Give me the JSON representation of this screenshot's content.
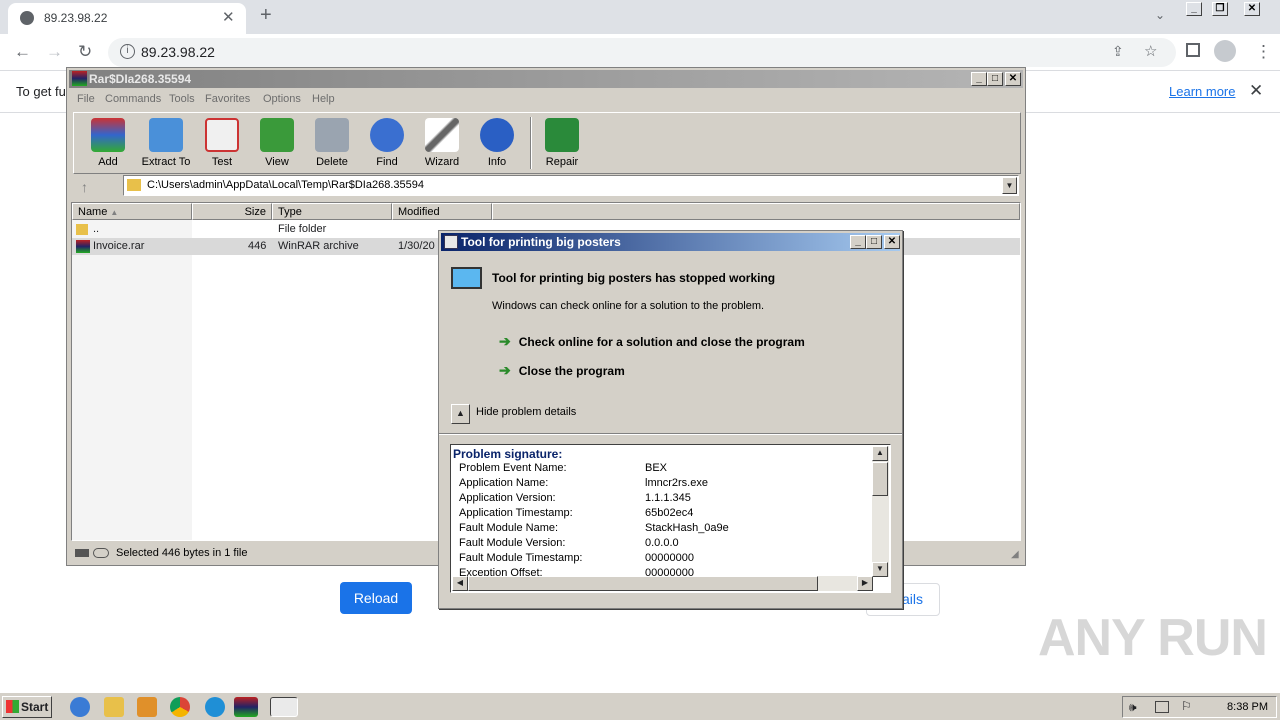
{
  "browser": {
    "tab_title": "89.23.98.22",
    "tab_close": "✕",
    "new_tab": "+",
    "url": "89.23.98.22",
    "infobar_text": "To get fu",
    "learn_more": "Learn more",
    "infobar_close": "✕",
    "reload_label": "Reload",
    "details_label": "ails"
  },
  "winrar": {
    "title": "Rar$DIa268.35594",
    "menu": [
      "File",
      "Commands",
      "Tools",
      "Favorites",
      "Options",
      "Help"
    ],
    "toolbar": [
      "Add",
      "Extract To",
      "Test",
      "View",
      "Delete",
      "Find",
      "Wizard",
      "Info",
      "Repair"
    ],
    "path": "C:\\Users\\admin\\AppData\\Local\\Temp\\Rar$DIa268.35594",
    "columns": {
      "name": "Name",
      "size": "Size",
      "type": "Type",
      "modified": "Modified"
    },
    "rows": [
      {
        "name": "..",
        "size": "",
        "type": "File folder",
        "modified": ""
      },
      {
        "name": "Invoice.rar",
        "size": "446",
        "type": "WinRAR archive",
        "modified": "1/30/20"
      }
    ],
    "status": "Selected 446 bytes in 1 file"
  },
  "dialog": {
    "title": "Tool for printing big posters",
    "heading": "Tool for printing big posters has stopped working",
    "subtext": "Windows can check online for a solution to the problem.",
    "option1": "Check online for a solution and close the program",
    "option2": "Close the program",
    "toggle_label": "Hide problem details",
    "details_title": "Problem signature:",
    "details": [
      {
        "k": "Problem Event Name:",
        "v": "BEX"
      },
      {
        "k": "Application Name:",
        "v": "lmncr2rs.exe"
      },
      {
        "k": "Application Version:",
        "v": "1.1.1.345"
      },
      {
        "k": "Application Timestamp:",
        "v": "65b02ec4"
      },
      {
        "k": "Fault Module Name:",
        "v": "StackHash_0a9e"
      },
      {
        "k": "Fault Module Version:",
        "v": "0.0.0.0"
      },
      {
        "k": "Fault Module Timestamp:",
        "v": "00000000"
      },
      {
        "k": "Exception Offset:",
        "v": "00000000"
      }
    ]
  },
  "taskbar": {
    "start": "Start",
    "clock": "8:38 PM"
  },
  "watermark": "ANY RUN"
}
